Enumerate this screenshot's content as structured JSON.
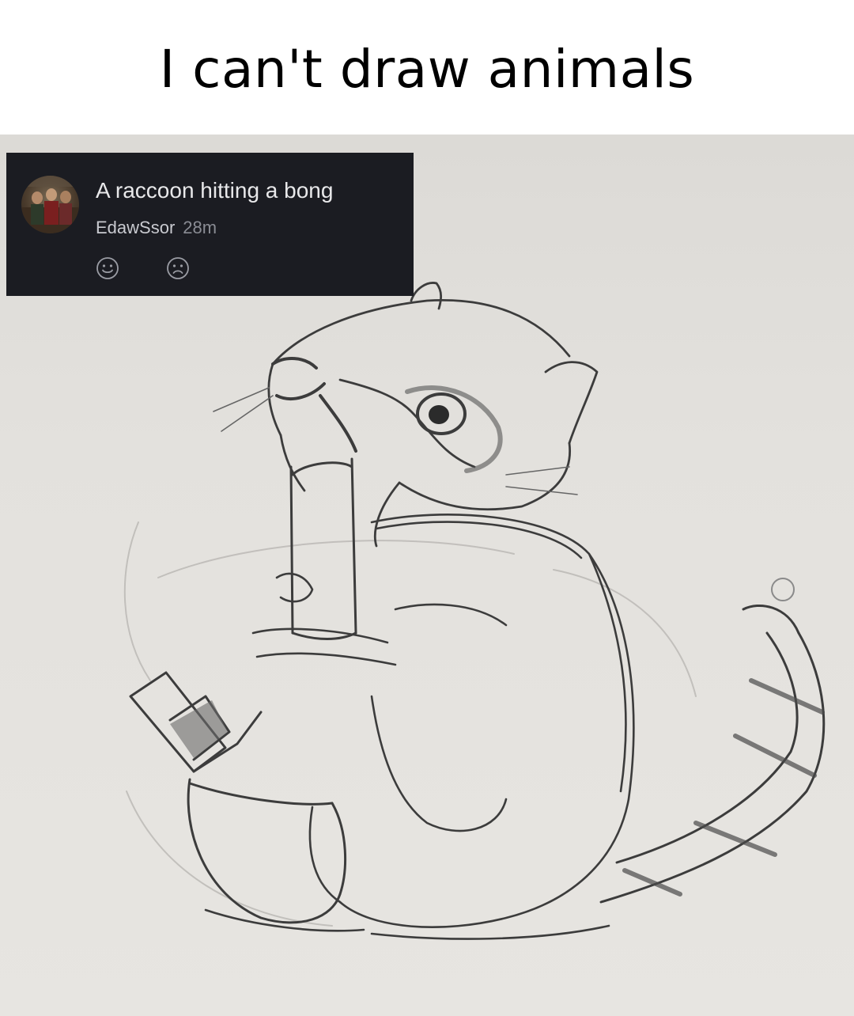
{
  "caption": "I can't draw animals",
  "comment": {
    "text": "A raccoon hitting a bong",
    "username": "EdawSsor",
    "timestamp": "28m",
    "reactions": [
      "smile-icon",
      "frown-icon"
    ]
  },
  "colors": {
    "card_background": "#1b1c22",
    "paper": "#e3e1dd",
    "pencil": "#3a3a3a"
  }
}
